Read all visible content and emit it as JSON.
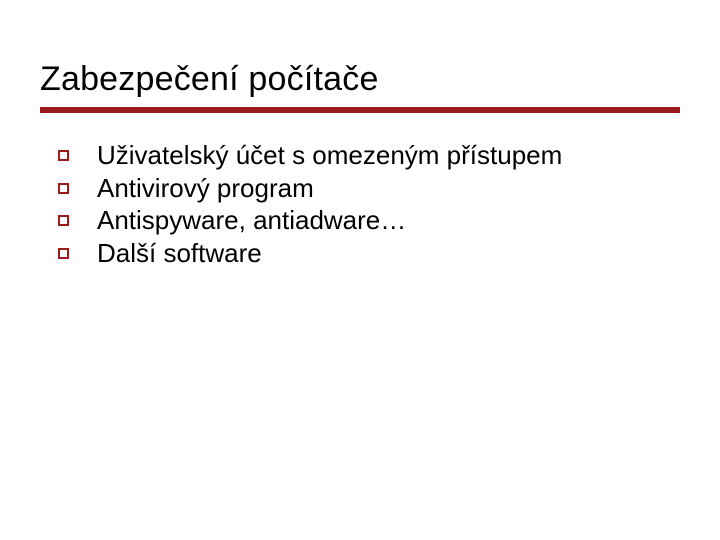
{
  "title": "Zabezpečení počítače",
  "items": [
    "Uživatelský účet s omezeným přístupem",
    "Antivirový program",
    "Antispyware, antiadware…",
    "Další software"
  ],
  "accent_color": "#9a1c1c"
}
